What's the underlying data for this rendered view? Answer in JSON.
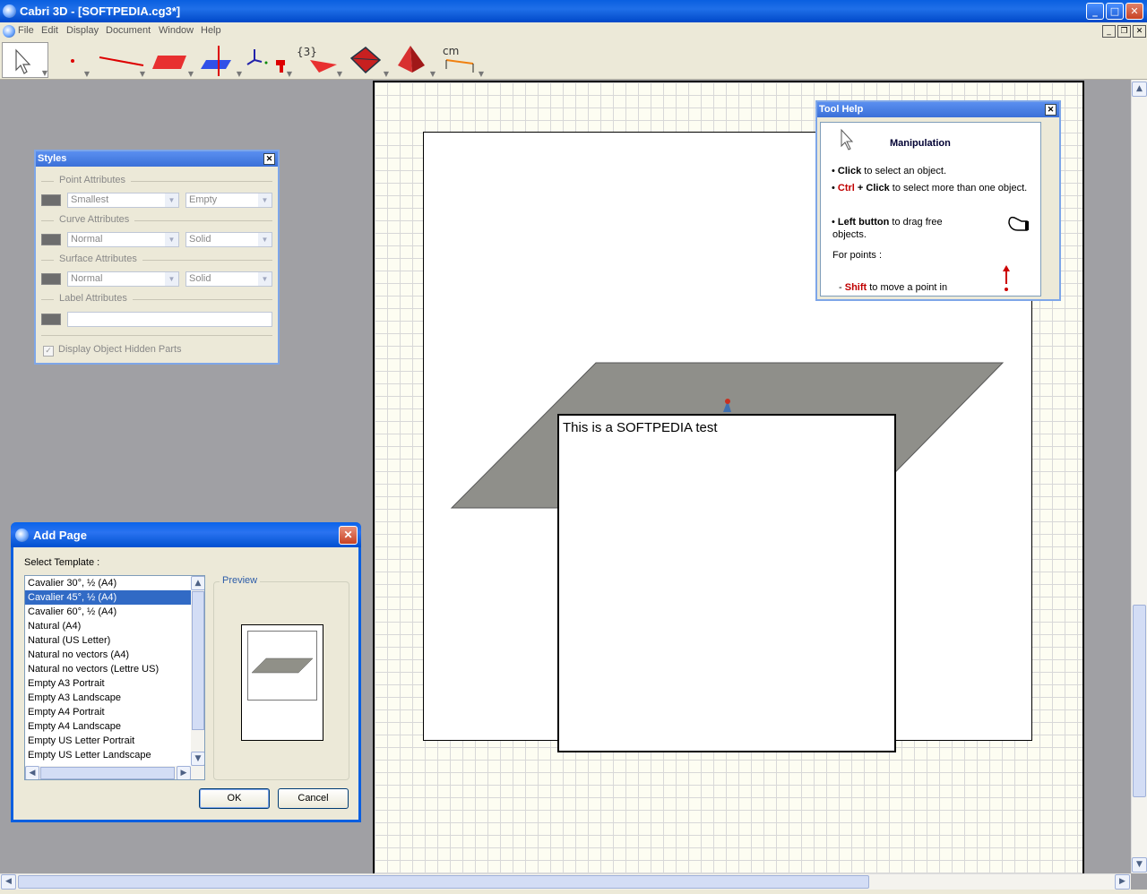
{
  "window": {
    "title": "Cabri 3D - [SOFTPEDIA.cg3*]",
    "min": "_",
    "max": "□",
    "close": "✕"
  },
  "menu": {
    "items": [
      "File",
      "Edit",
      "Display",
      "Document",
      "Window",
      "Help"
    ]
  },
  "toolbar": {
    "polygon_count_label": "{3}",
    "measure_label": "cm"
  },
  "workspace": {
    "textbox_text": "This is a SOFTPEDIA test",
    "plane_color": "#8f8f8a"
  },
  "styles_panel": {
    "title": "Styles",
    "point_section": "Point Attributes",
    "point_size": "Smallest",
    "point_style": "Empty",
    "curve_section": "Curve Attributes",
    "curve_thickness": "Normal",
    "curve_style": "Solid",
    "surface_section": "Surface Attributes",
    "surface_thickness": "Normal",
    "surface_style": "Solid",
    "label_section": "Label Attributes",
    "label_value": "",
    "hidden_parts_label": "Display Object Hidden Parts",
    "hidden_parts_checked": true
  },
  "tool_help": {
    "title": "Tool Help",
    "heading": "Manipulation",
    "click_bold": "Click",
    "click_text": " to select an object.",
    "ctrl_red": "Ctrl",
    "ctrl_plus": " + ",
    "ctrl_click_bold": "Click",
    "ctrl_text": " to select more than one object.",
    "left_bold": "Left button",
    "left_text": " to drag free",
    "left_text2": "objects.",
    "for_points": "For points :",
    "shift_red": "Shift",
    "shift_text": " to move a point in"
  },
  "add_page_dialog": {
    "title": "Add Page",
    "select_template_label": "Select Template :",
    "templates": [
      "Cavalier 30°, ½ (A4)",
      "Cavalier 45°, ½ (A4)",
      "Cavalier 60°, ½ (A4)",
      "Natural (A4)",
      "Natural (US Letter)",
      "Natural no vectors (A4)",
      "Natural no vectors (Lettre US)",
      "Empty A3 Portrait",
      "Empty A3 Landscape",
      "Empty A4 Portrait",
      "Empty A4 Landscape",
      "Empty US Letter Portrait",
      "Empty US Letter Landscape"
    ],
    "selected_index": 1,
    "preview_label": "Preview",
    "ok_label": "OK",
    "cancel_label": "Cancel"
  }
}
